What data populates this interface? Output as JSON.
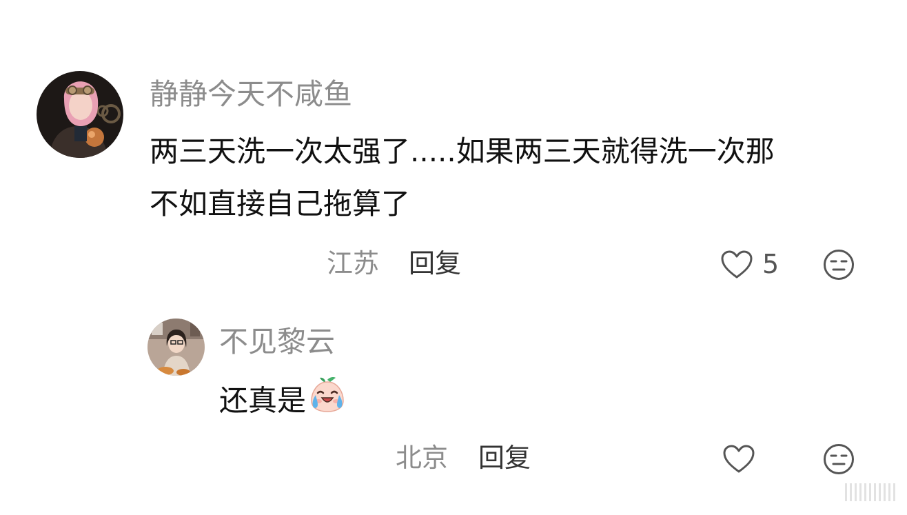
{
  "comments": [
    {
      "username": "静静今天不咸鱼",
      "content_line1": "两三天洗一次太强了.....如果两三天就得洗一次那",
      "content_line2": "不如直接自己拖算了",
      "location": "江苏",
      "reply_label": "回复",
      "like_count": "5",
      "like_icon": "heart-outline-icon",
      "emoji_icon": "neutral-face-icon"
    },
    {
      "username": "不见黎云",
      "content": "还真是",
      "inline_emoji": "crying-laughing-peach-emoji",
      "location": "北京",
      "reply_label": "回复",
      "like_icon": "heart-outline-icon",
      "emoji_icon": "neutral-face-icon"
    }
  ],
  "colors": {
    "username": "#8c8c8c",
    "content": "#111111",
    "icon_stroke": "#555555"
  }
}
